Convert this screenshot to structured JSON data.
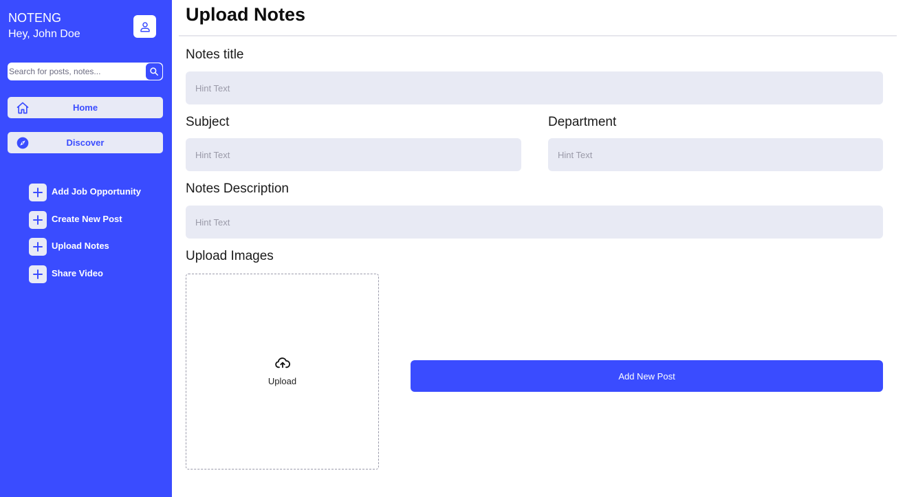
{
  "sidebar": {
    "app_name": "NOTENG",
    "greeting": "Hey, John Doe",
    "profile_icon": "user-icon",
    "search": {
      "placeholder": "Search for posts, notes...",
      "icon": "search-icon"
    },
    "nav": {
      "home": {
        "label": "Home",
        "icon": "home-icon"
      },
      "discover": {
        "label": "Discover",
        "icon": "compass-icon"
      }
    },
    "actions": [
      {
        "label": "Add Job Opportunity",
        "icon": "plus-icon"
      },
      {
        "label": "Create New Post",
        "icon": "plus-icon"
      },
      {
        "label": "Upload Notes",
        "icon": "plus-icon"
      },
      {
        "label": "Share Video",
        "icon": "plus-icon"
      }
    ]
  },
  "main": {
    "title": "Upload Notes",
    "form": {
      "notes_title": {
        "label": "Notes title",
        "placeholder": "Hint Text"
      },
      "subject": {
        "label": "Subject",
        "placeholder": "Hint Text"
      },
      "department": {
        "label": "Department",
        "placeholder": "Hint Text"
      },
      "description": {
        "label": "Notes Description",
        "placeholder": "Hint Text"
      },
      "images": {
        "label": "Upload Images",
        "upload_text": "Upload",
        "icon": "cloud-upload-icon"
      }
    },
    "submit_label": "Add New Post"
  },
  "colors": {
    "accent": "#3a4cff",
    "input_bg": "#e8eaf4",
    "nav_bg": "#e8eaf6"
  }
}
